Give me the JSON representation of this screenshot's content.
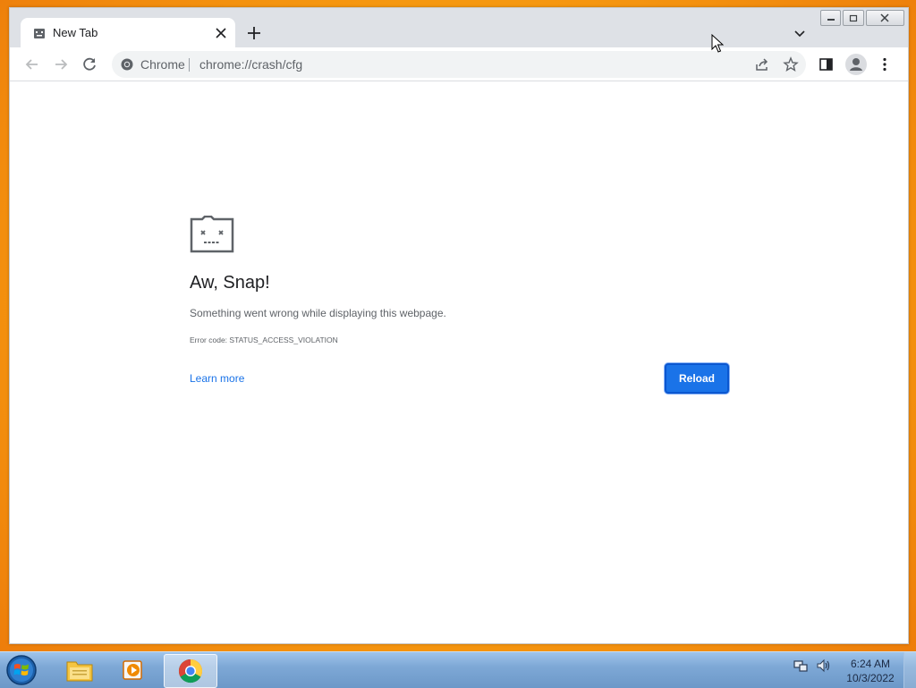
{
  "browser": {
    "tab": {
      "title": "New Tab"
    },
    "omnibox": {
      "chip": "Chrome",
      "url": "chrome://crash/cfg"
    }
  },
  "error_page": {
    "heading": "Aw, Snap!",
    "message": "Something went wrong while displaying this webpage.",
    "error_code": "Error code: STATUS_ACCESS_VIOLATION",
    "learn_more": "Learn more",
    "reload": "Reload"
  },
  "taskbar": {
    "items": [
      "windows-explorer",
      "media-player",
      "google-chrome"
    ],
    "clock": {
      "time": "6:24 AM",
      "date": "10/3/2022"
    }
  },
  "colors": {
    "accent": "#1a73e8",
    "desktop": "#f79a10"
  }
}
